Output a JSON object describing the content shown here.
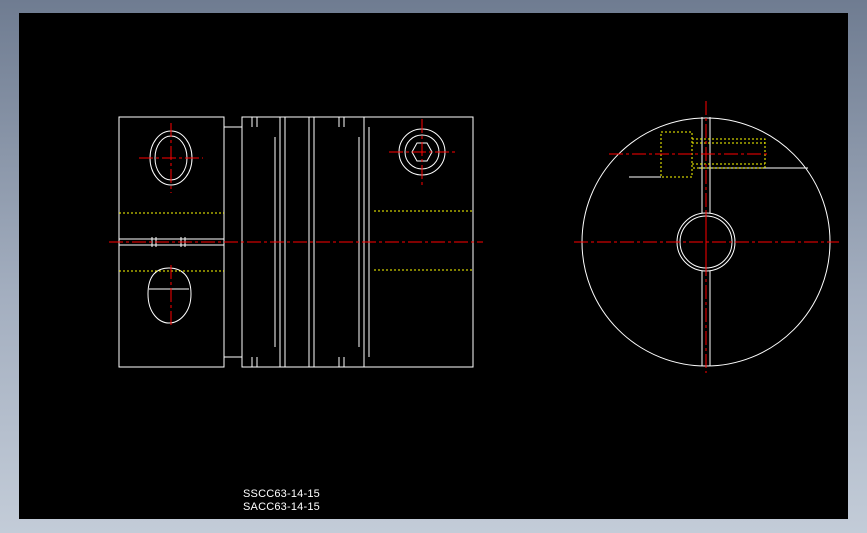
{
  "drawing": {
    "part_numbers": [
      "SSCC63-14-15",
      "SACC63-14-15"
    ],
    "colors": {
      "background": "#000000",
      "outline": "#ffffff",
      "centerline": "#ff0000",
      "hidden_line": "#ffff00",
      "window_frame": "#8f9bb0"
    },
    "views": [
      "side-view",
      "end-view"
    ]
  }
}
